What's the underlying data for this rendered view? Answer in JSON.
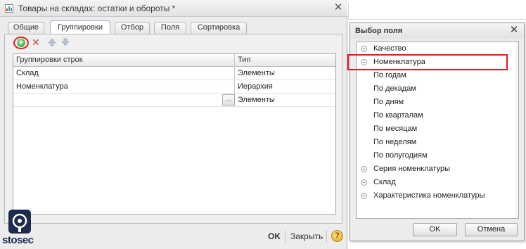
{
  "main_window": {
    "title": "Товары на складах: остатки и обороты *",
    "close_glyph": "✕",
    "tabs": [
      {
        "label": "Общие"
      },
      {
        "label": "Группировки"
      },
      {
        "label": "Отбор"
      },
      {
        "label": "Поля"
      },
      {
        "label": "Сортировка"
      }
    ],
    "active_tab": "Группировки",
    "toolbar": {
      "add_icon": "add-green-plus-icon",
      "delete_icon": "delete-red-x-icon",
      "up_icon": "arrow-up-icon",
      "down_icon": "arrow-down-icon"
    },
    "table": {
      "columns": [
        "Группировки строк",
        "Тип"
      ],
      "rows": [
        {
          "name": "Склад",
          "type": "Элементы"
        },
        {
          "name": "Номенклатура",
          "type": "Иерархия"
        },
        {
          "name": "",
          "type": "Элементы"
        }
      ],
      "ellipsis": "..."
    },
    "bottom": {
      "ok_label": "OK",
      "close_label": "Закрыть",
      "help_label": "?"
    }
  },
  "logo": {
    "text": "stosec"
  },
  "field_window": {
    "title": "Выбор поля",
    "close_glyph": "✕",
    "items": [
      {
        "label": "Качество",
        "expandable": true,
        "level": 0
      },
      {
        "label": "Номенклатура",
        "expandable": true,
        "level": 0,
        "highlighted": true
      },
      {
        "label": "По годам",
        "expandable": false,
        "level": 1
      },
      {
        "label": "По декадам",
        "expandable": false,
        "level": 1
      },
      {
        "label": "По дням",
        "expandable": false,
        "level": 1
      },
      {
        "label": "По кварталам",
        "expandable": false,
        "level": 1
      },
      {
        "label": "По месяцам",
        "expandable": false,
        "level": 1
      },
      {
        "label": "По неделям",
        "expandable": false,
        "level": 1
      },
      {
        "label": "По полугодиям",
        "expandable": false,
        "level": 1
      },
      {
        "label": "Серия номенклатуры",
        "expandable": true,
        "level": 0
      },
      {
        "label": "Склад",
        "expandable": true,
        "level": 0
      },
      {
        "label": "Характеристика номенклатуры",
        "expandable": true,
        "level": 0
      }
    ],
    "ok_label": "OK",
    "cancel_label": "Отмена"
  },
  "colors": {
    "highlight_red": "#e01b24",
    "add_green": "#2e9b2e",
    "window_bg": "#ececec"
  }
}
